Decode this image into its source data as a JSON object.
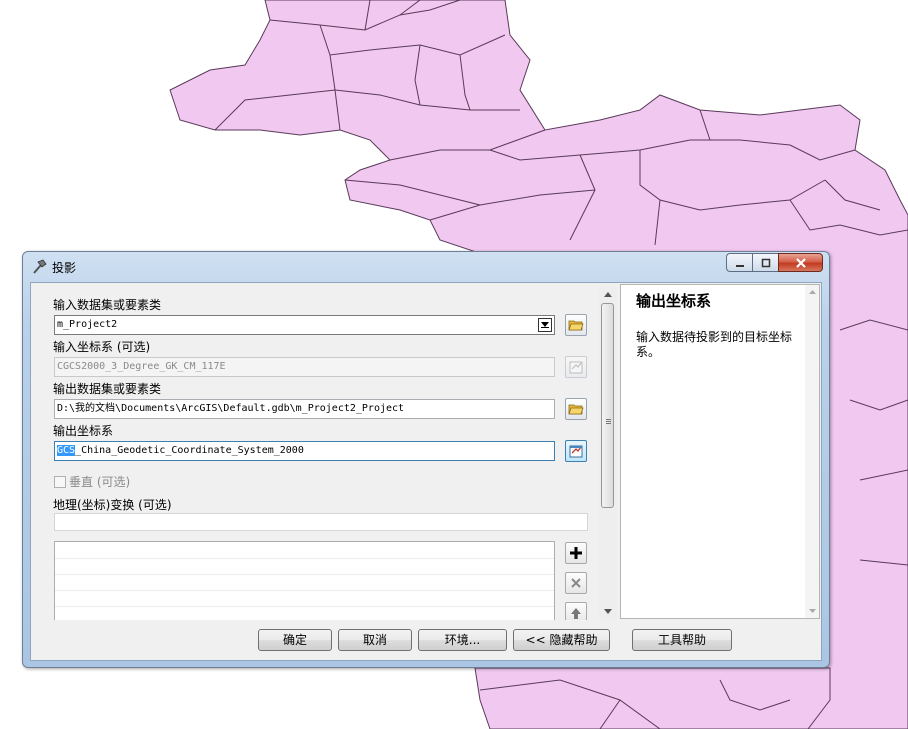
{
  "window": {
    "title": "投影",
    "controls": [
      "minimize-icon",
      "maximize-icon",
      "close-icon"
    ]
  },
  "form": {
    "input_dataset": {
      "label": "输入数据集或要素类",
      "value": "m_Project2"
    },
    "input_cs": {
      "label": "输入坐标系 (可选)",
      "value": "CGCS2000_3_Degree_GK_CM_117E"
    },
    "output_dataset": {
      "label": "输出数据集或要素类",
      "value": "D:\\我的文档\\Documents\\ArcGIS\\Default.gdb\\m_Project2_Project"
    },
    "output_cs": {
      "label": "输出坐标系",
      "value_selected": "GCS",
      "value_rest": "_China_Geodetic_Coordinate_System_2000"
    },
    "vertical": {
      "label": "垂直 (可选)",
      "checked": false
    },
    "transformation": {
      "label": "地理(坐标)变换 (可选)",
      "value": ""
    }
  },
  "help": {
    "title": "输出坐标系",
    "body": "输入数据待投影到的目标坐标系。"
  },
  "buttons": {
    "ok": "确定",
    "cancel": "取消",
    "environments": "环境...",
    "hide_help": "<< 隐藏帮助",
    "tool_help": "工具帮助"
  },
  "colors": {
    "map_fill": "#f0c8f0",
    "map_stroke": "#5a3a5a",
    "selection": "#3399ff",
    "title_gradient_start": "#cfe0f2",
    "close_button": "#c94a30"
  }
}
